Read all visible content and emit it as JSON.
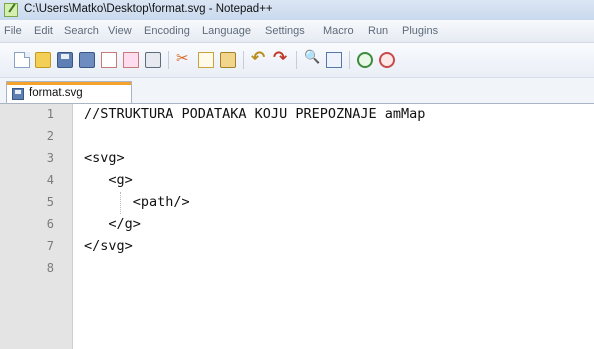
{
  "window": {
    "title": "C:\\Users\\Matko\\Desktop\\format.svg - Notepad++",
    "background_text": "...",
    "app_icon": "notepad-plus-plus-icon"
  },
  "menu": {
    "items": [
      "File",
      "Edit",
      "Search",
      "View",
      "Encoding",
      "Language",
      "Settings",
      "Macro",
      "Run",
      "Plugins"
    ]
  },
  "toolbar": {
    "buttons": [
      "new-file-icon",
      "open-file-icon",
      "save-icon",
      "save-all-icon",
      "close-icon",
      "close-all-icon",
      "print-icon",
      "cut-icon",
      "copy-icon",
      "paste-icon",
      "undo-icon",
      "redo-icon",
      "find-icon",
      "replace-icon",
      "zoom-in-icon",
      "zoom-out-icon"
    ]
  },
  "tabs": [
    {
      "label": "format.svg",
      "active": true,
      "icon": "saved-file-icon"
    }
  ],
  "editor": {
    "lines": [
      {
        "num": "1",
        "code": "//STRUKTURA PODATAKA KOJU PREPOZNAJE amMap"
      },
      {
        "num": "2",
        "code": ""
      },
      {
        "num": "3",
        "code": "<svg>"
      },
      {
        "num": "4",
        "code": "   <g>"
      },
      {
        "num": "5",
        "code": "      <path/>"
      },
      {
        "num": "6",
        "code": "   </g>"
      },
      {
        "num": "7",
        "code": "</svg>"
      },
      {
        "num": "8",
        "code": ""
      }
    ]
  },
  "colors": {
    "gutter": "#e4e4e4",
    "active_tab_accent": "#f3a32c",
    "menu_text": "#5f6b7a"
  }
}
